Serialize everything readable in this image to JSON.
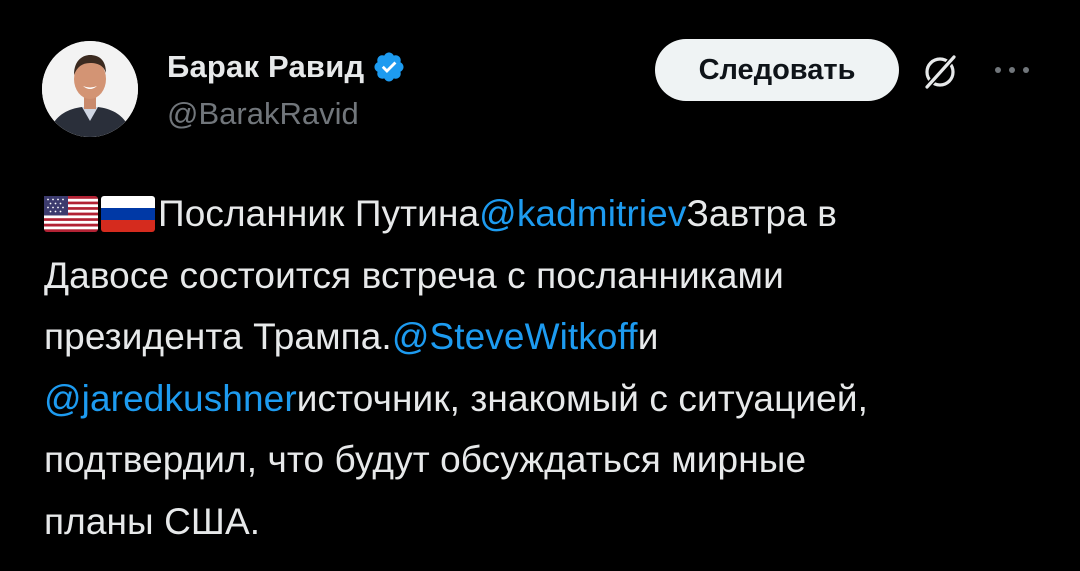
{
  "author": {
    "display_name": "Барак Равид",
    "handle": "@BarakRavid",
    "verified": true,
    "avatar_icon": "profile-photo"
  },
  "actions": {
    "follow_label": "Следовать",
    "grok_icon": "grok-slash-circle-icon",
    "more_icon": "ellipsis-icon"
  },
  "tweet": {
    "flags": [
      "us-flag-emoji",
      "russia-flag-emoji"
    ],
    "segments": [
      {
        "text": "Посланник Путина",
        "type": "text"
      },
      {
        "text": "@kadmitriev",
        "type": "mention"
      },
      {
        "text": "Завтра в",
        "type": "text"
      },
      {
        "text": "Давосе состоится встреча с посланниками",
        "type": "text"
      },
      {
        "text": "президента Трампа.",
        "type": "text"
      },
      {
        "text": "@SteveWitkoff",
        "type": "mention"
      },
      {
        "text": "и",
        "type": "text"
      },
      {
        "text": "@jaredkushner",
        "type": "mention"
      },
      {
        "text": "источник, знакомый с ситуацией,",
        "type": "text"
      },
      {
        "text": "подтвердил, что будут обсуждаться мирные",
        "type": "text"
      },
      {
        "text": "планы США.",
        "type": "text"
      }
    ]
  },
  "colors": {
    "background": "#000000",
    "text": "#e7e9ea",
    "secondary": "#71767b",
    "link": "#1d9bf0",
    "verified": "#1d9bf0",
    "follow_bg": "#eff3f4"
  }
}
